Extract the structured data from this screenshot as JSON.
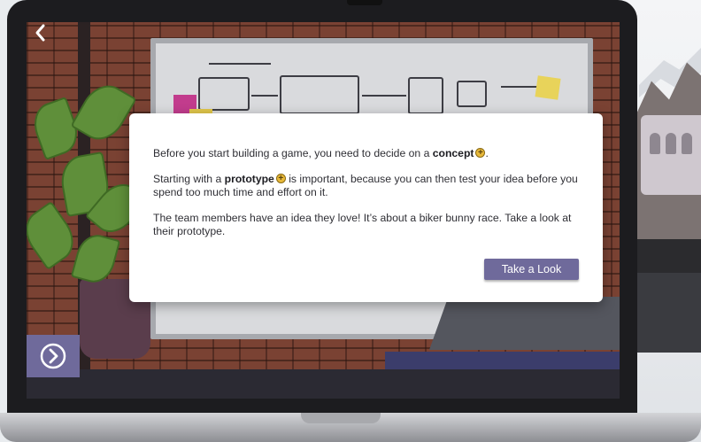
{
  "dialog": {
    "p1_before": "Before you start building a game, you need to decide on a ",
    "p1_term": "concept",
    "p1_after": ".",
    "p2_before": "Starting with a ",
    "p2_term": "prototype",
    "p2_after": " is important, because you can then test your idea before you spend too much time and effort on it.",
    "p3": "The team members have an idea they love! It’s about a biker bunny race. Take a look at their prototype.",
    "button_label": "Take a Look"
  },
  "icons": {
    "back": "chevron-left-icon",
    "next": "circle-chevron-right-icon",
    "term_info": "plus-circle-icon"
  },
  "colors": {
    "accent": "#6f6a9b",
    "term_badge": "#e8b93a",
    "dialog_bg": "#ffffff"
  }
}
